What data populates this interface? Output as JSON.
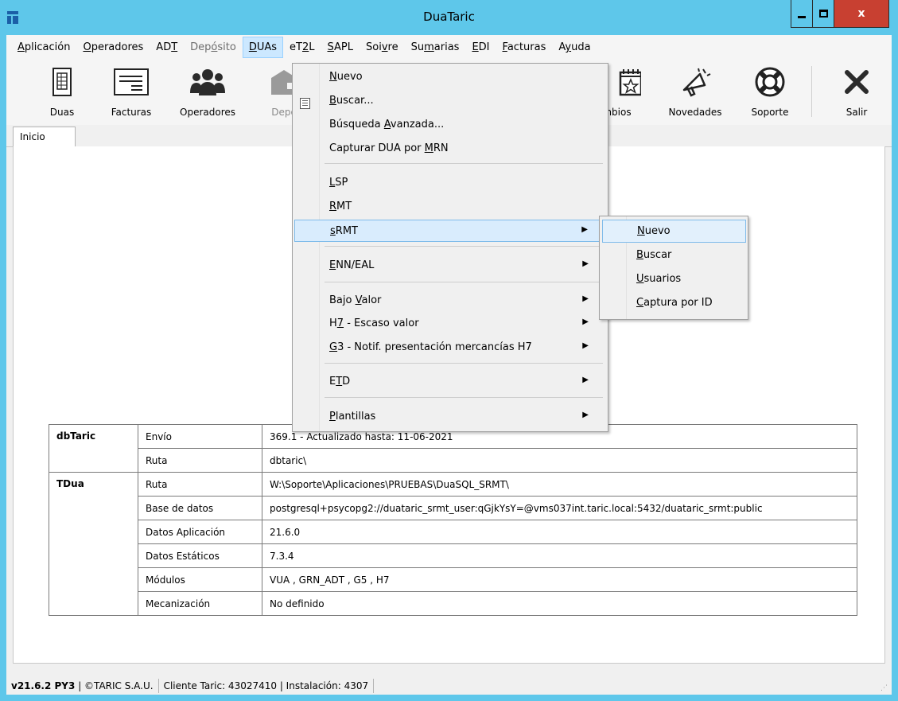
{
  "window": {
    "title": "DuaTaric",
    "close_label": "x"
  },
  "menubar": {
    "items": [
      {
        "pre": "",
        "u": "A",
        "post": "plicación"
      },
      {
        "pre": "",
        "u": "O",
        "post": "peradores"
      },
      {
        "pre": "AD",
        "u": "T",
        "post": ""
      },
      {
        "pre": "Dep",
        "u": "ó",
        "post": "sito"
      },
      {
        "pre": "",
        "u": "D",
        "post": "UAs"
      },
      {
        "pre": "eT",
        "u": "2",
        "post": "L"
      },
      {
        "pre": "",
        "u": "S",
        "post": "APL"
      },
      {
        "pre": "Soi",
        "u": "v",
        "post": "re"
      },
      {
        "pre": "Su",
        "u": "m",
        "post": "arias"
      },
      {
        "pre": "",
        "u": "E",
        "post": "DI"
      },
      {
        "pre": "",
        "u": "F",
        "post": "acturas"
      },
      {
        "pre": "A",
        "u": "y",
        "post": "uda"
      }
    ]
  },
  "toolbar": {
    "buttons": [
      {
        "label": "Duas",
        "icon": "document-icon"
      },
      {
        "label": "Facturas",
        "icon": "invoice-icon"
      },
      {
        "label": "Operadores",
        "icon": "users-icon"
      },
      {
        "label": "Depo",
        "icon": "warehouse-icon"
      },
      {
        "label": "ambios",
        "icon": "calendar-star-icon"
      },
      {
        "label": "Novedades",
        "icon": "megaphone-icon"
      },
      {
        "label": "Soporte",
        "icon": "lifebuoy-icon"
      },
      {
        "label": "Salir",
        "icon": "exit-x-icon"
      }
    ]
  },
  "tabs": {
    "home": "Inicio"
  },
  "info_table": {
    "rows": [
      {
        "section": "dbTaric",
        "key": "Envío",
        "value": "369.1 - Actualizado hasta: 11-06-2021"
      },
      {
        "section": "",
        "key": "Ruta",
        "value": "dbtaric\\"
      },
      {
        "section": "TDua",
        "key": "Ruta",
        "value": "W:\\Soporte\\Aplicaciones\\PRUEBAS\\DuaSQL_SRMT\\"
      },
      {
        "section": "",
        "key": "Base de datos",
        "value": "postgresql+psycopg2://duataric_srmt_user:qGjkYsY=@vms037int.taric.local:5432/duataric_srmt:public"
      },
      {
        "section": "",
        "key": "Datos Aplicación",
        "value": "21.6.0"
      },
      {
        "section": "",
        "key": "Datos Estáticos",
        "value": "7.3.4"
      },
      {
        "section": "",
        "key": "Módulos",
        "value": "VUA , GRN_ADT , G5 , H7"
      },
      {
        "section": "",
        "key": "Mecanización",
        "value": "No definido"
      }
    ]
  },
  "statusbar": {
    "version": "v21.6.2 PY3",
    "company": "| ©TARIC S.A.U.",
    "client": "Cliente Taric: 43027410 | Instalación: 4307"
  },
  "duas_menu": {
    "items": [
      {
        "pre": "",
        "u": "N",
        "post": "uevo",
        "submenu": false
      },
      {
        "pre": "",
        "u": "B",
        "post": "uscar...",
        "submenu": false
      },
      {
        "pre": "Búsqueda ",
        "u": "A",
        "post": "vanzada...",
        "submenu": false
      },
      {
        "pre": "Capturar DUA por ",
        "u": "M",
        "post": "RN",
        "submenu": false
      },
      {
        "pre": "",
        "u": "L",
        "post": "SP",
        "submenu": false
      },
      {
        "pre": "",
        "u": "R",
        "post": "MT",
        "submenu": false
      },
      {
        "pre": "",
        "u": "s",
        "post": "RMT",
        "submenu": true
      },
      {
        "pre": "",
        "u": "E",
        "post": "NN/EAL",
        "submenu": true
      },
      {
        "pre": "Bajo ",
        "u": "V",
        "post": "alor",
        "submenu": true
      },
      {
        "pre": "H",
        "u": "7",
        "post": " - Escaso valor",
        "submenu": true
      },
      {
        "pre": "",
        "u": "G",
        "post": "3 - Notif. presentación mercancías H7",
        "submenu": true
      },
      {
        "pre": "E",
        "u": "T",
        "post": "D",
        "submenu": true
      },
      {
        "pre": "",
        "u": "P",
        "post": "lantillas",
        "submenu": true
      }
    ]
  },
  "srmt_submenu": {
    "items": [
      {
        "pre": "",
        "u": "N",
        "post": "uevo"
      },
      {
        "pre": "",
        "u": "B",
        "post": "uscar"
      },
      {
        "pre": "",
        "u": "U",
        "post": "suarios"
      },
      {
        "pre": "",
        "u": "C",
        "post": "aptura por ID"
      }
    ]
  },
  "colors": {
    "titlebar": "#5ec7ea",
    "close_button": "#c84031",
    "menu_highlight": "#d9ecfd"
  }
}
